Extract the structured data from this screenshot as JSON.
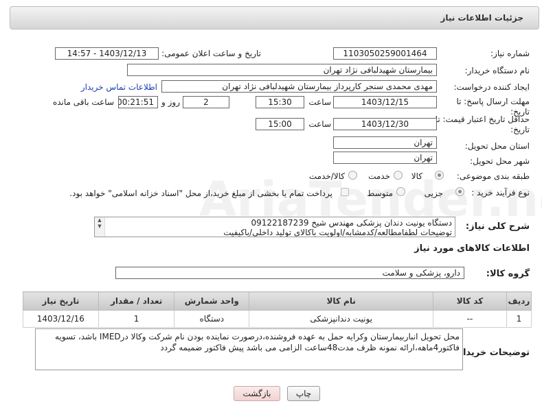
{
  "header": {
    "title": "جزئیات اطلاعات نیاز"
  },
  "form": {
    "need_number_label": "شماره نیاز:",
    "need_number": "1103050259001464",
    "announce_label": "تاریخ و ساعت اعلان عمومی:",
    "announce_value": "1403/12/13 - 14:57",
    "buyer_label": "نام دستگاه خریدار:",
    "buyer_value": "بیمارستان شهیدلبافی نژاد تهران",
    "creator_label": "ایجاد کننده درخواست:",
    "creator_value": "مهدی محمدی سنجر کارپرداز بیمارستان شهیدلبافی نژاد تهران",
    "contact_link": "اطلاعات تماس خریدار",
    "reply_label_1": "مهلت ارسال پاسخ: تا",
    "reply_label_2": "تاریخ:",
    "reply_date": "1403/12/15",
    "time_label": "ساعت",
    "reply_time": "15:30",
    "days_value": "2",
    "days_label": "روز و",
    "remaining_value": "00:21:51",
    "remaining_label": "ساعت باقی مانده",
    "validity_label_1": "حداقل تاریخ اعتبار قیمت: تا",
    "validity_label_2": "تاریخ:",
    "validity_date": "1403/12/30",
    "validity_time_label": "ساعت",
    "validity_time": "15:00",
    "province_label": "استان محل تحویل:",
    "province_value": "تهران",
    "city_label": "شهر محل تحویل:",
    "city_value": "تهران",
    "category_label": "طبقه بندی موضوعی:",
    "category_options": [
      "کالا",
      "خدمت",
      "کالا/خدمت"
    ],
    "process_label": "نوع فرآیند خرید :",
    "process_options": [
      "جزیی",
      "متوسط"
    ],
    "payment_text": "پرداخت تمام یا بخشی از مبلغ خرید،از محل \"اسناد خزانه اسلامی\" خواهد بود.",
    "desc_label": "شرح کلی نیاز:",
    "desc_line1": "دستگاه یونیت دندان پزشکی مهندس شیخ 09122187239",
    "desc_line2": "توضیحات لطفامطالعه/کدمشابه/اولویت باکالای تولید داخلی/باکیفیت"
  },
  "goods_section": {
    "title": "اطلاعات کالاهای مورد نیاز",
    "group_label": "گروه کالا:",
    "group_value": "دارو، پزشکی و سلامت",
    "columns": [
      "ردیف",
      "کد کالا",
      "نام کالا",
      "واحد شمارش",
      "تعداد / مقدار",
      "تاریخ نیاز"
    ],
    "rows": [
      {
        "row": "1",
        "code": "--",
        "name": "یونیت دندانپزشکی",
        "unit": "دستگاه",
        "qty": "1",
        "date": "1403/12/16"
      }
    ]
  },
  "buyer_notes": {
    "label": "توضیحات خریدار:",
    "line1": "محل تحویل انباربیمارستان وکرایه حمل به عهده فروشنده،درصورت نماینده بودن نام شرکت وکالا درIMED باشد، تسویه",
    "line2": "فاکتور4ماهه،ارائه نمونه ظرف مدت48ساعت الزامی می باشد پیش فاکتور ضمیمه گردد"
  },
  "buttons": {
    "print": "چاپ",
    "back": "بازگشت"
  },
  "watermark": "AriaTender.net",
  "colors": {
    "link": "#1a3fb0",
    "back_button_bg": "#f6dede"
  }
}
